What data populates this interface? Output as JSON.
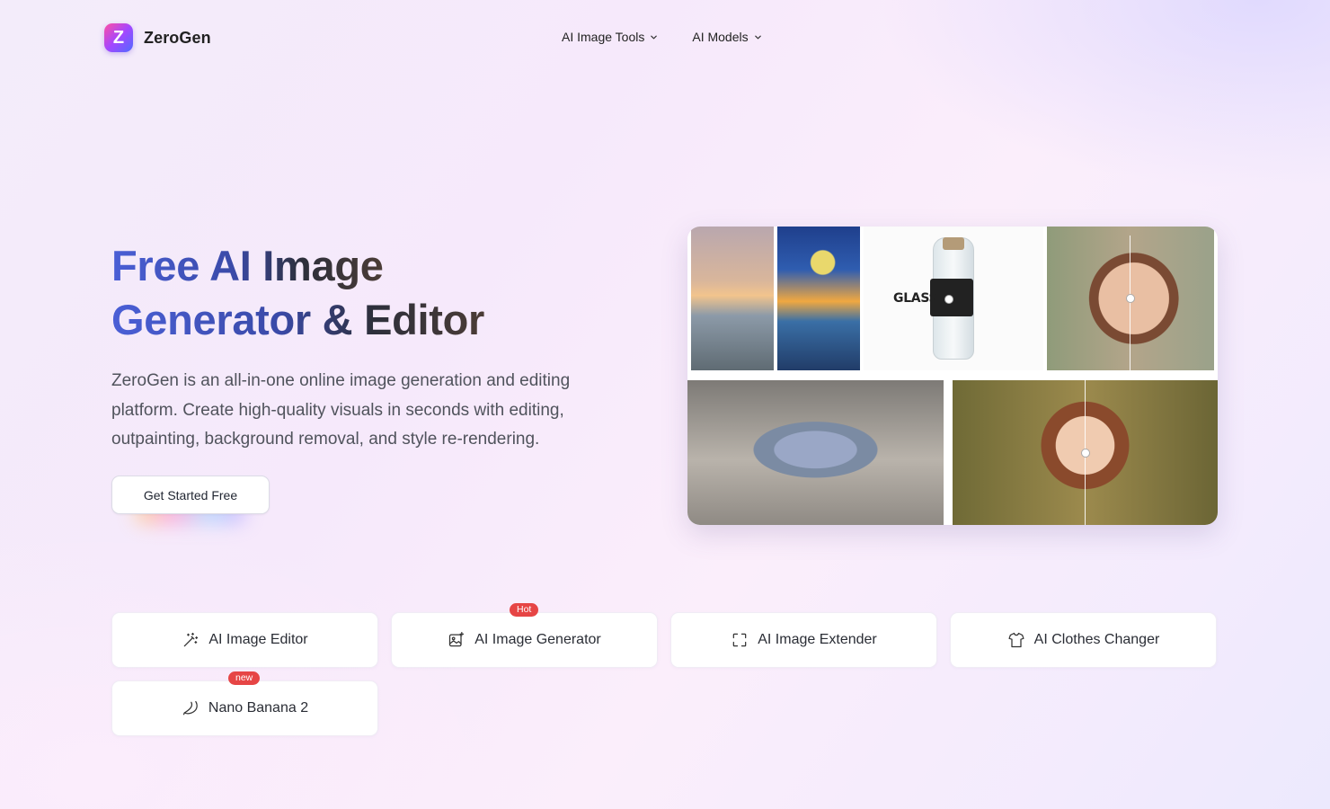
{
  "header": {
    "logo_letter": "Z",
    "brand": "ZeroGen",
    "nav": [
      {
        "label": "AI Image Tools"
      },
      {
        "label": "AI Models"
      }
    ]
  },
  "hero": {
    "title_line1": "Free AI Image",
    "title_line2": "Generator & Editor",
    "description": "ZeroGen is an all-in-one online image generation and editing platform. Create high-quality visuals in seconds with editing, outpainting, background removal, and style re-rendering.",
    "cta": "Get Started Free"
  },
  "collage": {
    "glass_text": "GLASS W"
  },
  "tools": [
    {
      "label": "AI Image Editor",
      "icon": "magic-wand-icon",
      "badge": ""
    },
    {
      "label": "AI Image Generator",
      "icon": "image-sparkle-icon",
      "badge": "Hot"
    },
    {
      "label": "AI Image Extender",
      "icon": "expand-frame-icon",
      "badge": ""
    },
    {
      "label": "AI Clothes Changer",
      "icon": "tshirt-icon",
      "badge": ""
    },
    {
      "label": "Nano Banana 2",
      "icon": "banana-icon",
      "badge": "new"
    }
  ],
  "colors": {
    "accent_gradient_start": "#4a5fd6",
    "badge_red": "#e64545",
    "logo_pink": "#ff4fa3",
    "logo_blue": "#4f6bff"
  }
}
